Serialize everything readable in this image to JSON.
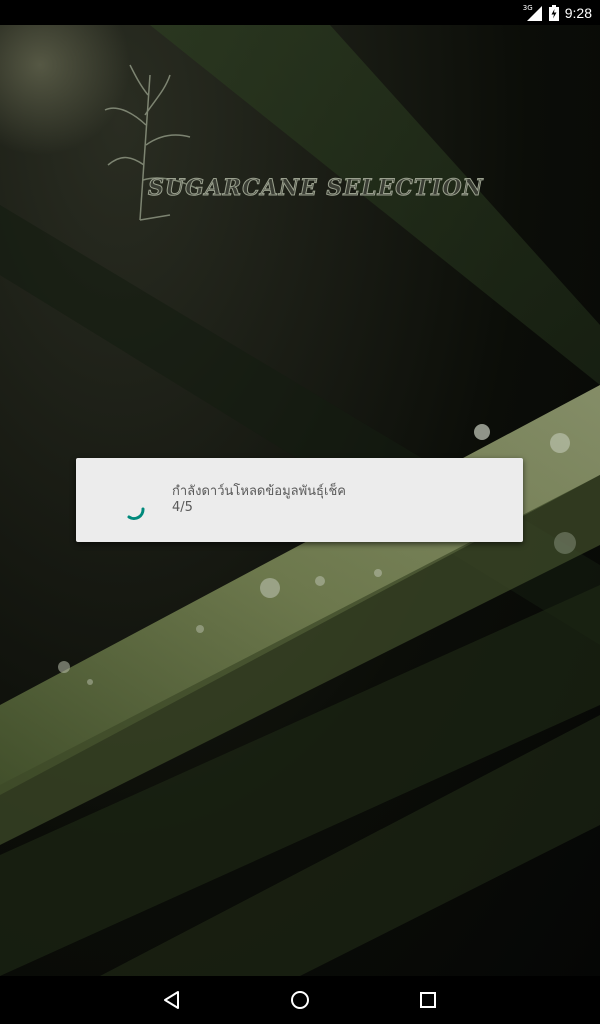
{
  "status_bar": {
    "network_label": "3G",
    "time": "9:28",
    "icons": [
      "signal-icon",
      "battery-icon"
    ]
  },
  "app": {
    "logo_text": "SUGARCANE SELECTION"
  },
  "dialog": {
    "message": "กำลังดาว์นโหลดข้อมูลพันธุ์เช็ค",
    "progress_text": "4/5",
    "spinner_color": "#00897b"
  },
  "nav_bar": {
    "buttons": [
      "back-icon",
      "home-icon",
      "recents-icon"
    ]
  }
}
